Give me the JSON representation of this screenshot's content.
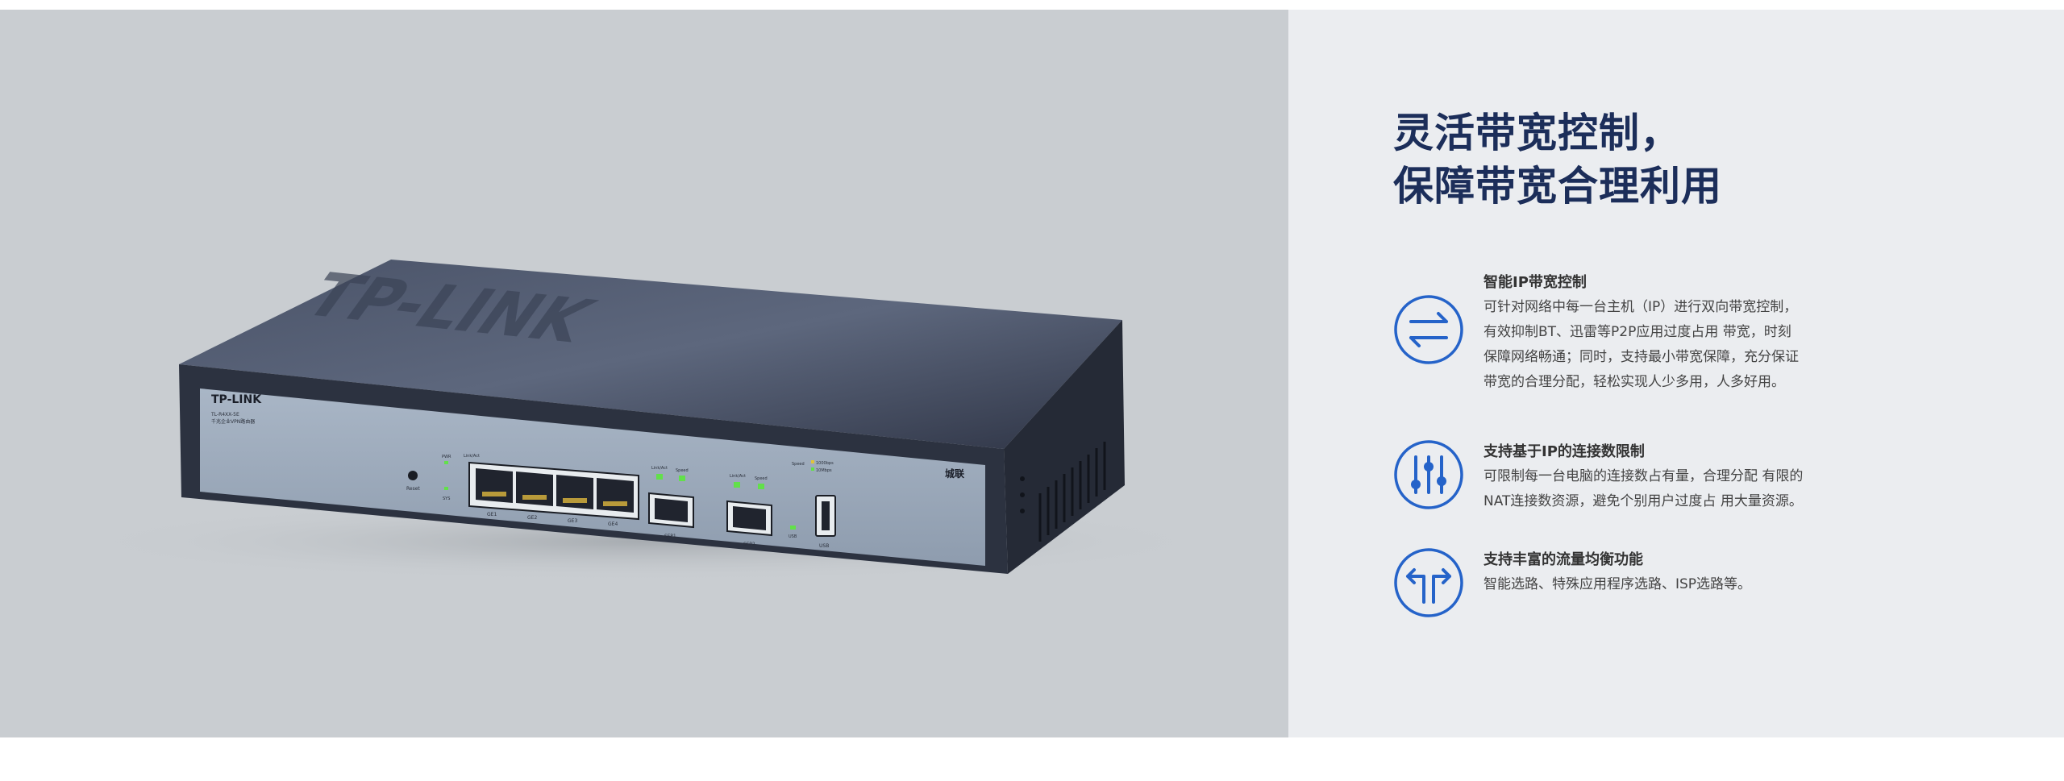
{
  "headline": {
    "line1": "灵活带宽控制，",
    "line2": "保障带宽合理利用"
  },
  "features": [
    {
      "icon": "bidirectional-arrows-icon",
      "title": "智能IP带宽控制",
      "lines": [
        "可针对网络中每一台主机（IP）进行双向带宽控制，",
        "有效抑制BT、迅雷等P2P应用过度占用 带宽，时刻",
        "保障网络畅通；同时，支持最小带宽保障，充分保证",
        "带宽的合理分配，轻松实现人少多用，人多好用。"
      ]
    },
    {
      "icon": "sliders-icon",
      "title": "支持基于IP的连接数限制",
      "lines": [
        "可限制每一台电脑的连接数占有量，合理分配 有限的",
        " NAT连接数资源，避免个别用户过度占 用大量资源。"
      ]
    },
    {
      "icon": "split-arrows-icon",
      "title": "支持丰富的流量均衡功能",
      "lines": [
        "智能选路、特殊应用程序选路、ISP选路等。"
      ]
    }
  ],
  "router": {
    "brand_top": "TP-LINK",
    "brand_front": "TP-LINK",
    "model": "TL-R4XX-5E",
    "subtitle": "千兆企业VPN路由器",
    "badge": "城联",
    "reset_label": "Reset",
    "pwr_label": "PWR",
    "sys_label": "SYS",
    "linkact_label": "Link/Act",
    "speed_label": "Speed",
    "port_labels": [
      "GE1",
      "GE2",
      "GE3",
      "GE4"
    ],
    "sfp1_label": "SFP1",
    "sfp2_label": "SFP2",
    "speed_1000": "1000bps",
    "speed_100": "10Mbps",
    "usb_label": "USB",
    "usb_led_label": "USB"
  },
  "colors": {
    "headline": "#1c2e5a",
    "accent_blue": "#2563c9",
    "photo_bg": "#c9cdd1",
    "text_bg": "#ebedf0"
  }
}
